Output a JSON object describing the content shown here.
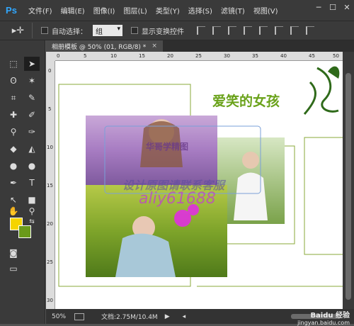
{
  "app": {
    "logo": "Ps"
  },
  "menu": [
    "文件(F)",
    "编辑(E)",
    "图像(I)",
    "图层(L)",
    "类型(Y)",
    "选择(S)",
    "滤镜(T)",
    "视图(V)"
  ],
  "window_controls": [
    "─",
    "☐",
    "✕"
  ],
  "options": {
    "auto_select_label": "自动选择：",
    "auto_select_value": "组",
    "show_transform_label": "显示变换控件"
  },
  "document_tab": {
    "title": "相册模板 @ 50% (01, RGB/8) *",
    "close": "×"
  },
  "ruler": {
    "h_labels": [
      "0",
      "5",
      "10",
      "15",
      "20",
      "25",
      "30",
      "35",
      "40",
      "45",
      "50"
    ],
    "v_labels": [
      "0",
      "5",
      "10",
      "15",
      "20",
      "25",
      "30"
    ]
  },
  "canvas": {
    "heading": "爱笑的女孩",
    "watermark_center": "华哥学精图",
    "watermark_line": "设计原图请联系客服",
    "watermark_number": "aliy61688"
  },
  "colors": {
    "foreground": "#f5d400",
    "background": "#6a9a1a",
    "frame": "#8aa83a"
  },
  "status": {
    "zoom": "50%",
    "doc_info": "文档:2.75M/10.4M",
    "brand": "Baidu 经验",
    "brand_url": "jingyan.baidu.com"
  }
}
